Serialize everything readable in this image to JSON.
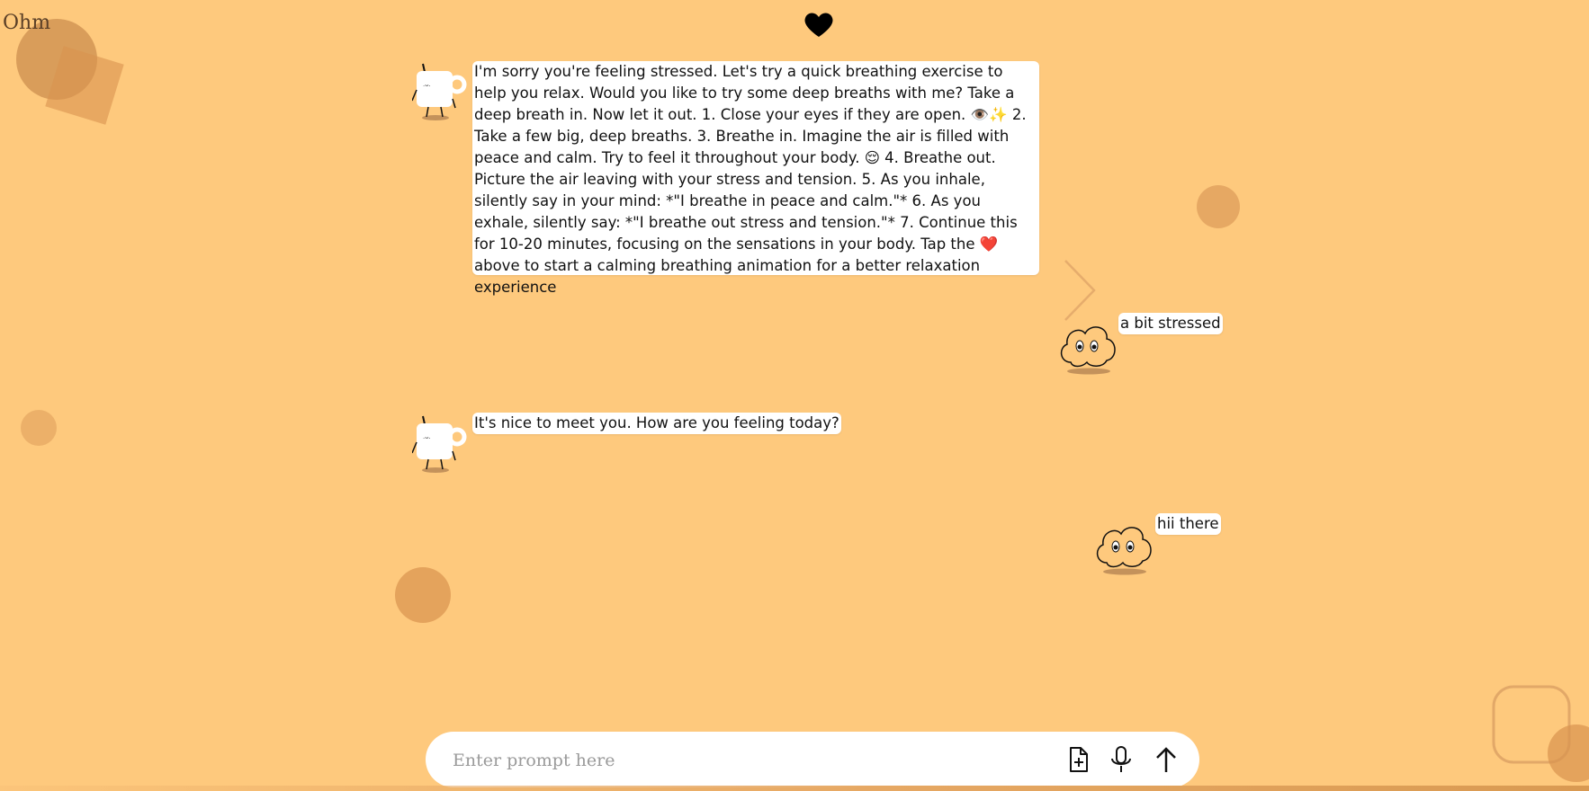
{
  "app": {
    "title": "Ohm"
  },
  "header": {
    "heart_icon": "heart-icon"
  },
  "messages": [
    {
      "role": "assistant",
      "text": "I'm sorry you're feeling stressed. Let's try a quick breathing exercise to help you relax. Would you like to try some deep breaths with me? Take a deep breath in. Now let it out. 1. Close your eyes if they are open. 👁️✨ 2. Take a few big, deep breaths. 3. Breathe in. Imagine the air is filled with peace and calm. Try to feel it throughout your body. 😌 4. Breathe out. Picture the air leaving with your stress and tension. 5. As you inhale, silently say in your mind: *\"I breathe in peace and calm.\"* 6. As you exhale, silently say: *\"I breathe out stress and tension.\"* 7. Continue this for 10-20 minutes, focusing on the sensations in your body. Tap the ❤️ above to start a calming breathing animation for a better relaxation experience",
      "avatar": "mug-character-icon"
    },
    {
      "role": "user",
      "text": "a bit stressed",
      "avatar": "cloud-character-icon"
    },
    {
      "role": "assistant",
      "text": "It's nice to meet you. How are you feeling today?",
      "avatar": "mug-character-icon"
    },
    {
      "role": "user",
      "text": "hii there",
      "avatar": "cloud-character-icon"
    }
  ],
  "prompt": {
    "placeholder": "Enter prompt here",
    "value": "",
    "attach_icon": "file-plus-icon",
    "mic_icon": "microphone-icon",
    "send_icon": "arrow-up-icon"
  },
  "colors": {
    "background": "#fec97d",
    "decor_shape": "#d9934f",
    "bubble": "#ffffff",
    "text": "#111111"
  }
}
